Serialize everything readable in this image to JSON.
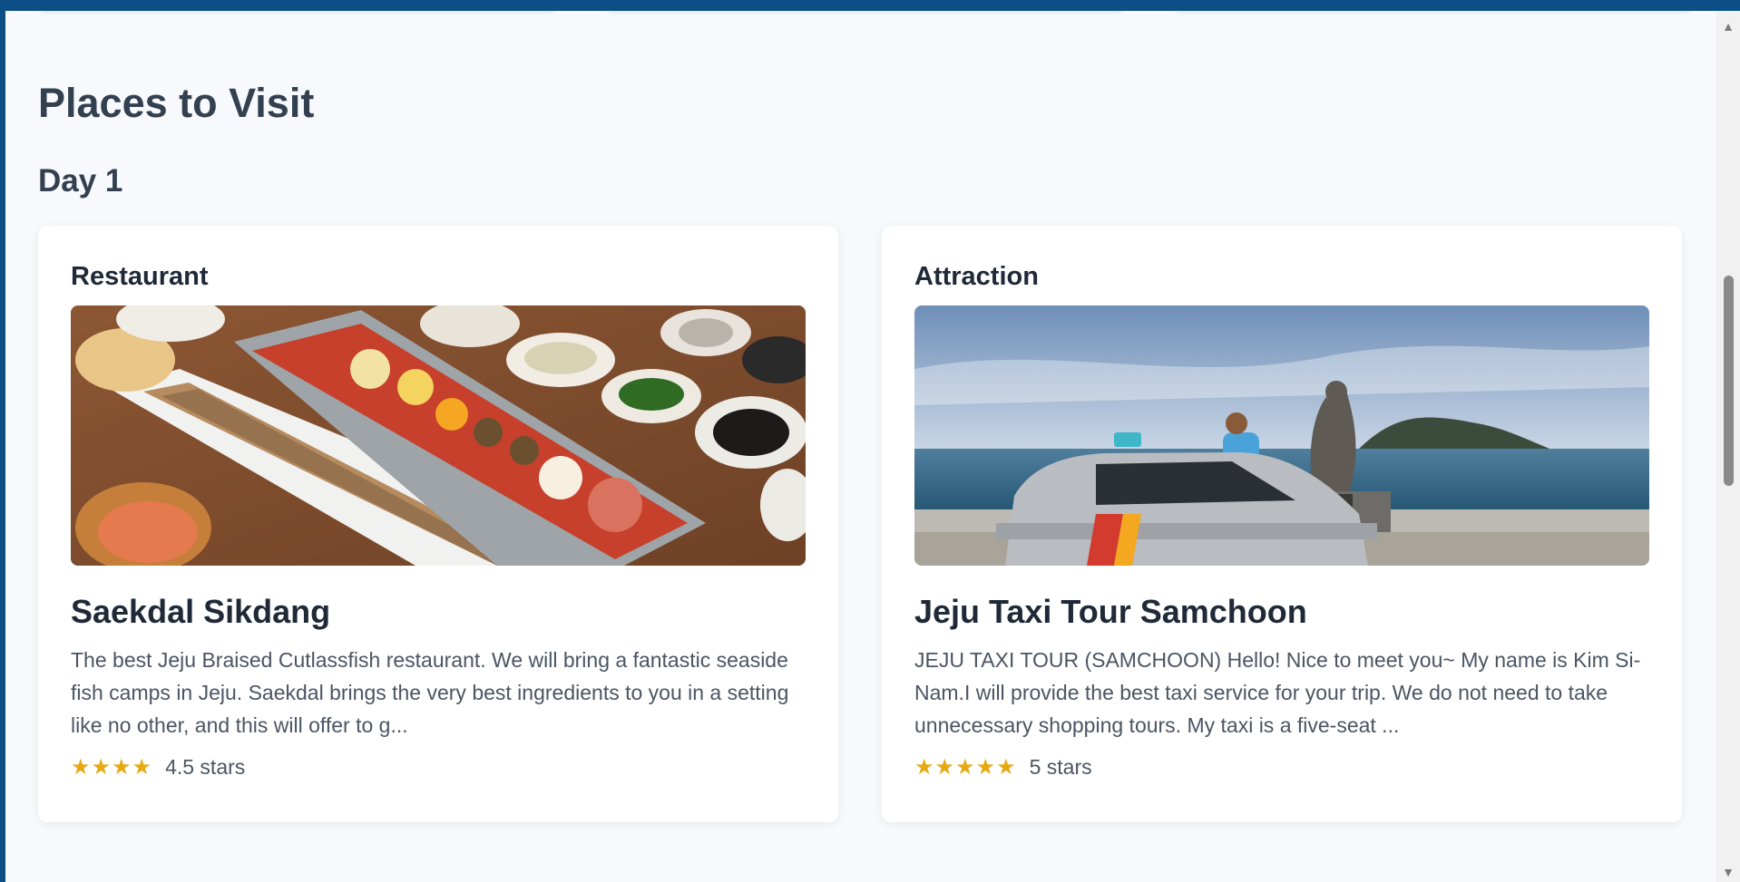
{
  "section": {
    "title": "Places to Visit"
  },
  "day": {
    "title": "Day 1"
  },
  "cards": [
    {
      "category": "Restaurant",
      "title": "Saekdal Sikdang",
      "description": "The best Jeju Braised Cutlassfish restaurant. We will bring a fantastic seaside fish camps in Jeju. Saekdal brings the very best ingredients to you in a setting like no other, and this will offer to g...",
      "stars": "★★★★",
      "rating_text": "4.5 stars",
      "image_icon": "food-spread-image"
    },
    {
      "category": "Attraction",
      "title": "Jeju Taxi Tour Samchoon",
      "description": "JEJU TAXI TOUR (SAMCHOON) Hello! Nice to meet you~ My name is Kim Si- Nam.I will provide the best taxi service for your trip. We do not need to take unnecessary shopping tours. My taxi is a five-seat ...",
      "stars": "★★★★★",
      "rating_text": "5 stars",
      "image_icon": "taxi-seaside-image"
    }
  ],
  "colors": {
    "frame": "#0b4f86",
    "page_bg": "#f7f9fc",
    "star": "#e7a912",
    "heading": "#33404f",
    "text": "#4b5563"
  },
  "scrollbar": {
    "up_icon": "scroll-up-arrow-icon",
    "down_icon": "scroll-down-arrow-icon"
  }
}
